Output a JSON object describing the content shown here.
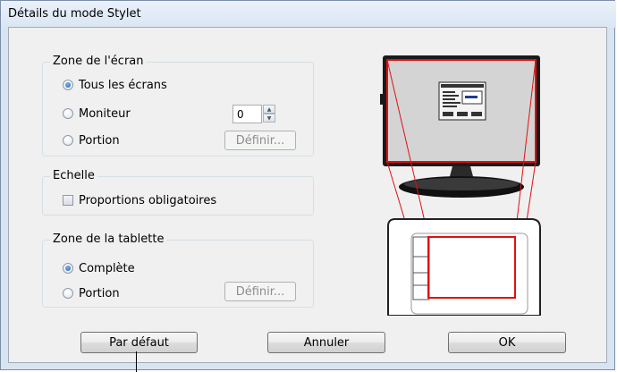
{
  "dialog": {
    "title": "Détails du mode Stylet"
  },
  "screen_area": {
    "legend": "Zone de l'écran",
    "options": [
      {
        "label": "Tous les écrans",
        "selected": true
      },
      {
        "label": "Moniteur",
        "selected": false
      },
      {
        "label": "Portion",
        "selected": false
      }
    ],
    "monitor_value": "0",
    "define_label": "Définir..."
  },
  "scale": {
    "legend": "Echelle",
    "force_proportions_label": "Proportions obligatoires",
    "force_proportions_checked": false
  },
  "tablet_area": {
    "legend": "Zone de la tablette",
    "options": [
      {
        "label": "Complète",
        "selected": true
      },
      {
        "label": "Portion",
        "selected": false
      }
    ],
    "define_label": "Définir..."
  },
  "buttons": {
    "default": "Par défaut",
    "cancel": "Annuler",
    "ok": "OK"
  },
  "colors": {
    "mapping_red": "#e01010",
    "monitor_body": "#1a1a1a",
    "screen_fill": "#d4d4d4"
  }
}
